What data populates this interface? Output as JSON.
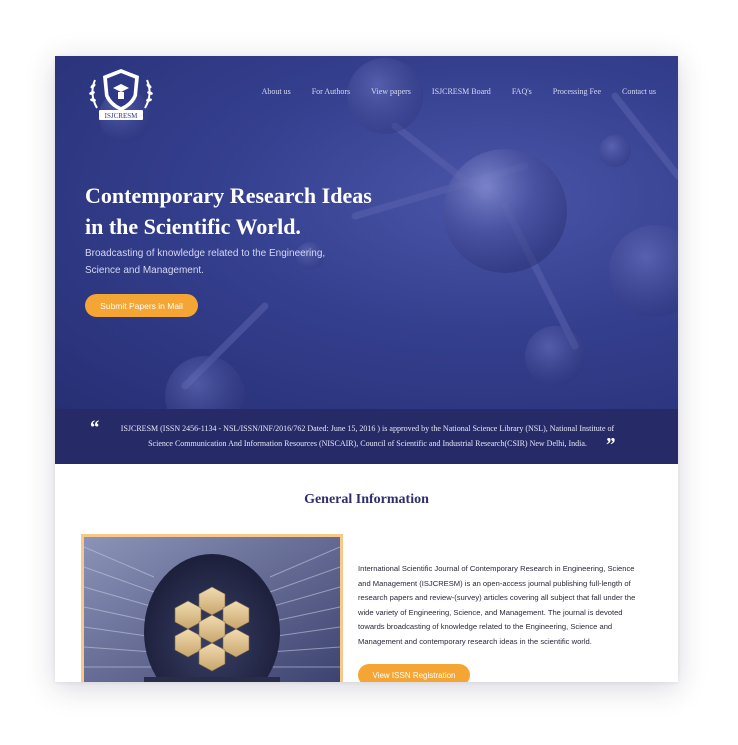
{
  "brand": {
    "logo_text": "ISJCRESM",
    "accent": "#f5a533",
    "primary": "#2f3885",
    "band": "#262b68",
    "logo_icon": "shield-wreath-icon"
  },
  "nav": {
    "items": [
      {
        "label": "About us"
      },
      {
        "label": "For Authors"
      },
      {
        "label": "View papers"
      },
      {
        "label": "ISJCRESM Board"
      },
      {
        "label": "FAQ's"
      },
      {
        "label": "Processing Fee"
      },
      {
        "label": "Contact us"
      }
    ]
  },
  "hero": {
    "title_line1": "Contemporary Research Ideas",
    "title_line2": "in the Scientific World.",
    "subtitle_line1": "Broadcasting of knowledge related to the Engineering,",
    "subtitle_line2": "Science and Management.",
    "button_label": "Submit Papers in Mail"
  },
  "quote": {
    "open_mark": "“",
    "close_mark": "”",
    "line1": "ISJCRESM (ISSN 2456-1134 - NSL/ISSN/INF/2016/762 Dated: June 15, 2016 ) is approved by the National Science Library (NSL), National Institute of",
    "line2": "Science Communication And Information Resources (NISCAIR), Council of Scientific and Industrial Research(CSIR) New Delhi, India."
  },
  "general": {
    "title": "General Information",
    "lines": [
      "International Scientific Journal of Contemporary Research in Engineering, Science",
      "and Management (ISJCRESM) is an open-access journal publishing full-length of",
      "research papers and review-(survey) articles covering all subject that fall under the",
      "wide variety of Engineering, Science, and Management. The journal is devoted",
      "towards broadcasting of knowledge related to the Engineering, Science and",
      "Management and contemporary research ideas in the scientific world."
    ],
    "button_label": "View ISSN Registration"
  }
}
